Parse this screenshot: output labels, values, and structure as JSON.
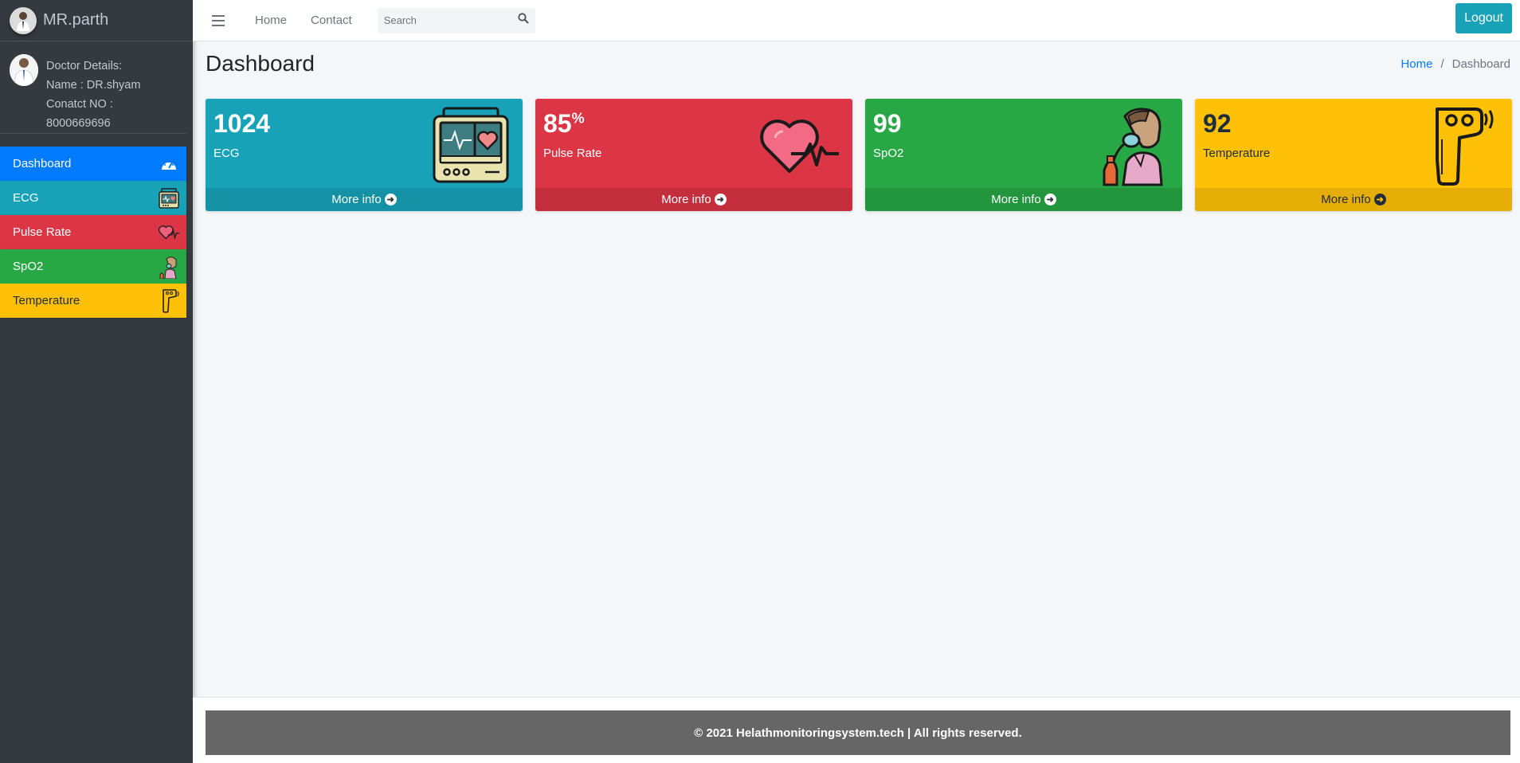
{
  "brand": {
    "name": "MR.parth"
  },
  "user_panel": {
    "heading": "Doctor Details:",
    "name": "Name : DR.shyam",
    "contact": "Conatct NO : 8000669696"
  },
  "sidebar": {
    "items": [
      {
        "label": "Dashboard",
        "icon": "speedometer-icon",
        "color": "#007bff"
      },
      {
        "label": "ECG",
        "icon": "ecg-monitor-icon",
        "color": "#17a2b8"
      },
      {
        "label": "Pulse Rate",
        "icon": "heart-pulse-icon",
        "color": "#dc3545"
      },
      {
        "label": "SpO2",
        "icon": "oxygen-mask-icon",
        "color": "#28a745"
      },
      {
        "label": "Temperature",
        "icon": "thermometer-gun-icon",
        "color": "#ffc107"
      }
    ]
  },
  "topbar": {
    "menu_icon": "hamburger-icon",
    "links": [
      "Home",
      "Contact"
    ],
    "search_placeholder": "Search",
    "search_icon": "search-icon",
    "logout_label": "Logout"
  },
  "content": {
    "title": "Dashboard",
    "breadcrumb": {
      "home": "Home",
      "separator": "/",
      "current": "Dashboard"
    }
  },
  "cards": [
    {
      "value": "1024",
      "unit": "",
      "label": "ECG",
      "footer": "More info",
      "icon": "ecg-monitor-icon",
      "color": "#17a2b8"
    },
    {
      "value": "85",
      "unit": "%",
      "label": "Pulse Rate",
      "footer": "More info",
      "icon": "heart-pulse-icon",
      "color": "#dc3545"
    },
    {
      "value": "99",
      "unit": "",
      "label": "SpO2",
      "footer": "More info",
      "icon": "oxygen-mask-icon",
      "color": "#28a745"
    },
    {
      "value": "92",
      "unit": "",
      "label": "Temperature",
      "footer": "More info",
      "icon": "thermometer-gun-icon",
      "color": "#ffc107"
    }
  ],
  "footer": {
    "text": "© 2021 Helathmonitoringsystem.tech | All rights reserved."
  }
}
